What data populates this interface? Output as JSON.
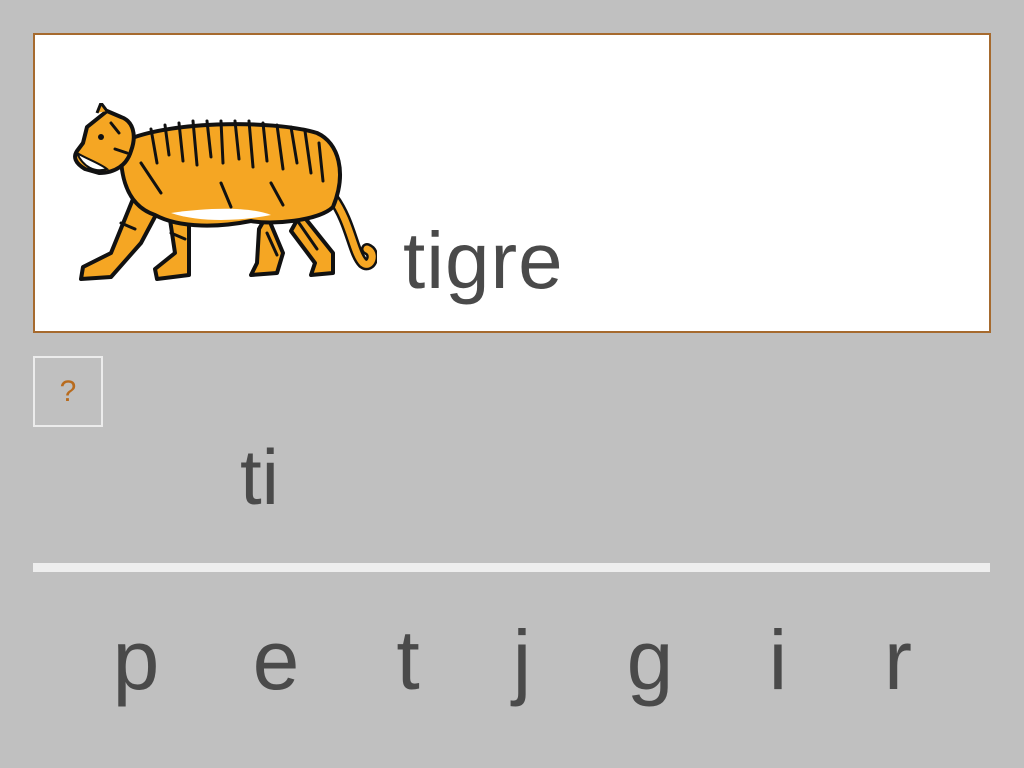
{
  "card": {
    "word": "tigre",
    "image_icon": "tiger-illustration"
  },
  "hint": {
    "label": "?"
  },
  "answer": {
    "text": "ti"
  },
  "letters": [
    "p",
    "e",
    "t",
    "j",
    "g",
    "i",
    "r"
  ],
  "colors": {
    "background": "#c0c0c0",
    "card_border": "#a66a2e",
    "text": "#4a4a4a",
    "hint_text": "#b86b1e",
    "tiger_orange": "#f5a623"
  }
}
